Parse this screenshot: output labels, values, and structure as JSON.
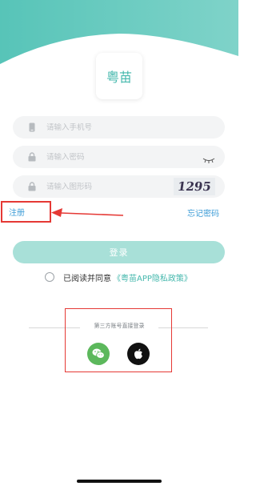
{
  "app": {
    "logo_text": "粤苗",
    "theme_color": "#45b8ad"
  },
  "form": {
    "phone_placeholder": "请输入手机号",
    "password_placeholder": "请输入密码",
    "captcha_placeholder": "请输入图形码",
    "captcha_text": "1295"
  },
  "links": {
    "register": "注册",
    "forgot_password": "忘记密码"
  },
  "login_button": "登录",
  "agreement": {
    "text": "已阅读并同意",
    "policy": "《粤苗APP隐私政策》"
  },
  "third_party": {
    "label": "第三方账号直接登录",
    "providers": [
      {
        "name": "wechat",
        "icon": "wechat-icon",
        "color": "#5cb85c"
      },
      {
        "name": "apple",
        "icon": "apple-icon",
        "color": "#111111"
      }
    ]
  },
  "annotation_color": "#e53935"
}
